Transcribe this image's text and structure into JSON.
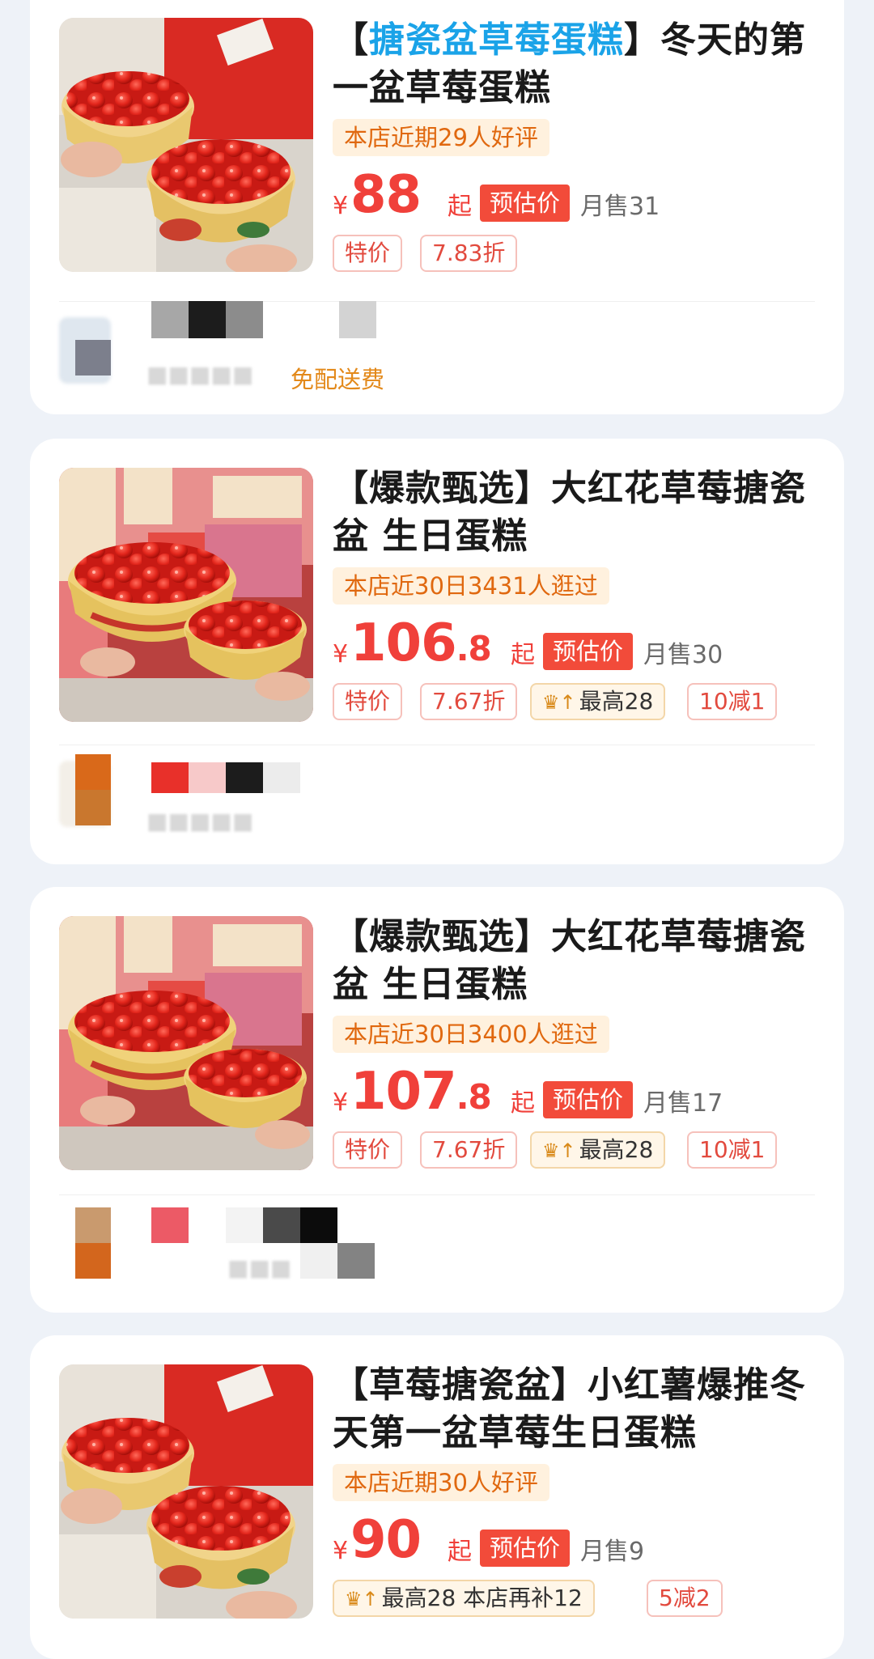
{
  "listings": [
    {
      "title_highlight": "搪瓷盆草莓蛋糕",
      "title_prefix": "【",
      "title_suffix": "】冬天的第一盆草莓蛋糕",
      "badge": "本店近期29人好评",
      "currency": "¥",
      "price_int": "88",
      "price_dec": "",
      "price_suffix": "起",
      "estimate_label": "预估价",
      "monthly_sales": "月售31",
      "tags": [
        "特价",
        "7.83折"
      ],
      "delivery": "免配送费"
    },
    {
      "title": "【爆款甄选】大红花草莓搪瓷盆 生日蛋糕",
      "badge": "本店近30日3431人逛过",
      "currency": "¥",
      "price_int": "106",
      "price_dec": ".8",
      "price_suffix": "起",
      "estimate_label": "预估价",
      "monthly_sales": "月售30",
      "tags": [
        "特价",
        "7.67折",
        "最高28",
        "10减1"
      ]
    },
    {
      "title": "【爆款甄选】大红花草莓搪瓷盆 生日蛋糕",
      "badge": "本店近30日3400人逛过",
      "currency": "¥",
      "price_int": "107",
      "price_dec": ".8",
      "price_suffix": "起",
      "estimate_label": "预估价",
      "monthly_sales": "月售17",
      "tags": [
        "特价",
        "7.67折",
        "最高28",
        "10减1"
      ]
    },
    {
      "title": "【草莓搪瓷盆】小红薯爆推冬天第一盆草莓生日蛋糕",
      "badge": "本店近期30人好评",
      "currency": "¥",
      "price_int": "90",
      "price_dec": "",
      "price_suffix": "起",
      "estimate_label": "预估价",
      "monthly_sales": "月售9",
      "tags": [
        "最高28 本店再补12",
        "5减2"
      ]
    }
  ],
  "icons": {
    "crown": "crown-up-icon"
  },
  "colors": {
    "price": "#f0403a",
    "highlight": "#1aa3e8",
    "badge_text": "#e0680f",
    "delivery": "#e3891a"
  }
}
